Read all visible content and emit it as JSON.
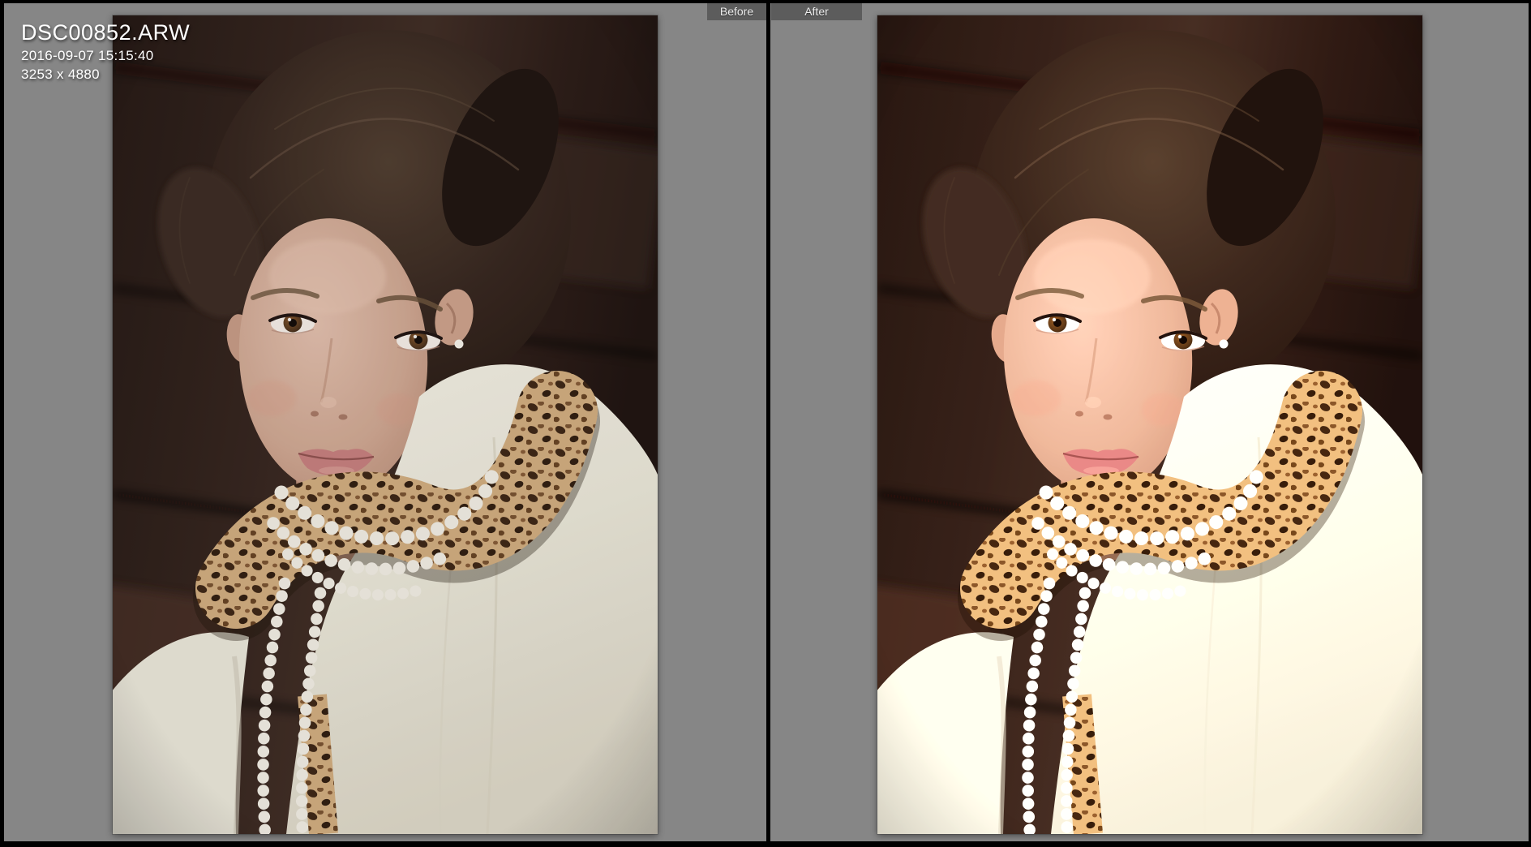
{
  "overlay": {
    "filename": "DSC00852.ARW",
    "datetime": "2016-09-07 15:15:40",
    "dimensions": "3253 x 4880"
  },
  "tabs": {
    "before": "Before",
    "after": "After"
  },
  "colors": {
    "workspace_background": "#868686",
    "frame_border": "#000000",
    "tab_background": "#5c5c5c",
    "tab_text": "#ededed",
    "overlay_text": "#ffffff"
  }
}
